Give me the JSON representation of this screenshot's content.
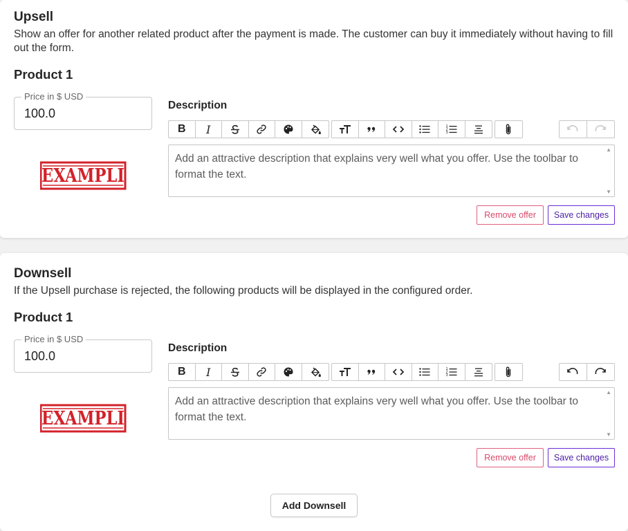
{
  "upsell": {
    "title": "Upsell",
    "description": "Show an offer for another related product after the payment is made. The customer can buy it immediately without having to fill out the form.",
    "product": {
      "title": "Product 1",
      "price_label": "Price in $ USD",
      "price_value": "100.0",
      "stamp_text": "EXAMPLI",
      "description_label": "Description",
      "editor_placeholder": "Add an attractive description that explains very well what you offer. Use the toolbar to format the text.",
      "undo_enabled": false,
      "remove_label": "Remove offer",
      "save_label": "Save changes"
    }
  },
  "downsell": {
    "title": "Downsell",
    "description": "If the Upsell purchase is rejected, the following products will be displayed in the configured order.",
    "product": {
      "title": "Product 1",
      "price_label": "Price in $ USD",
      "price_value": "100.0",
      "stamp_text": "EXAMPLI",
      "description_label": "Description",
      "editor_placeholder": "Add an attractive description that explains very well what you offer. Use the toolbar to format the text.",
      "undo_enabled": true,
      "remove_label": "Remove offer",
      "save_label": "Save changes"
    },
    "add_button": "Add Downsell"
  },
  "toolbar": {
    "bold": "B",
    "italic": "I",
    "icons": [
      "strikethrough-icon",
      "link-icon",
      "palette-icon",
      "fill-color-icon",
      "text-size-icon",
      "quote-icon",
      "code-icon",
      "bullet-list-icon",
      "numbered-list-icon",
      "align-center-icon",
      "attachment-icon",
      "undo-icon",
      "redo-icon"
    ]
  },
  "colors": {
    "stamp_red": "#d3222a",
    "remove_accent": "#d84a6a",
    "save_accent": "#4b1fa6"
  }
}
